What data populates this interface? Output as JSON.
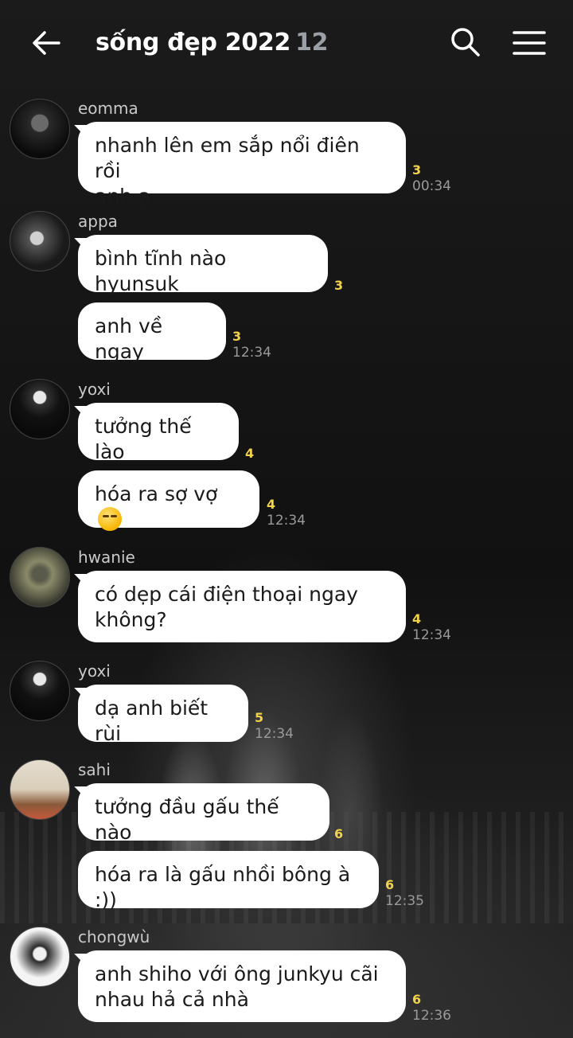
{
  "header": {
    "back_icon": "arrow-left-icon",
    "title": "sống đẹp 2022",
    "member_count": "12",
    "search_icon": "search-icon",
    "menu_icon": "hamburger-menu-icon"
  },
  "colors": {
    "bubble": "#ffffff",
    "unread": "#f2d24a",
    "title": "#ffffff",
    "count": "#9aa0a6"
  },
  "messages": [
    {
      "sender": "eomma",
      "text_lines": [
        "nhanh lên em sắp nổi điên rồi",
        "anh ạ"
      ],
      "unread": "3",
      "time": "00:34"
    },
    {
      "sender": "appa",
      "text": "bình tĩnh nào hyunsuk",
      "unread": "3"
    },
    {
      "text": "anh về ngay",
      "unread": "3",
      "time": "12:34"
    },
    {
      "sender": "yoxi",
      "text": "tưởng thế lào",
      "unread": "4"
    },
    {
      "text": "hóa ra sợ vợ",
      "emoji": "smirking-face-emoji",
      "unread": "4",
      "time": "12:34"
    },
    {
      "sender": "hwanie",
      "text_lines": [
        "có dẹp cái điện thoại ngay",
        "không?"
      ],
      "unread": "4",
      "time": "12:34"
    },
    {
      "sender": "yoxi",
      "text": "dạ anh biết rùi",
      "unread": "5",
      "time": "12:34"
    },
    {
      "sender": "sahi",
      "text": "tưởng đầu gấu thế nào",
      "unread": "6"
    },
    {
      "text": "hóa ra là gấu nhồi bông à :))",
      "unread": "6",
      "time": "12:35"
    },
    {
      "sender": "chongwù",
      "text_lines": [
        "anh shiho với ông junkyu cãi",
        "nhau hả cả nhà"
      ],
      "unread": "6",
      "time": "12:36"
    }
  ]
}
